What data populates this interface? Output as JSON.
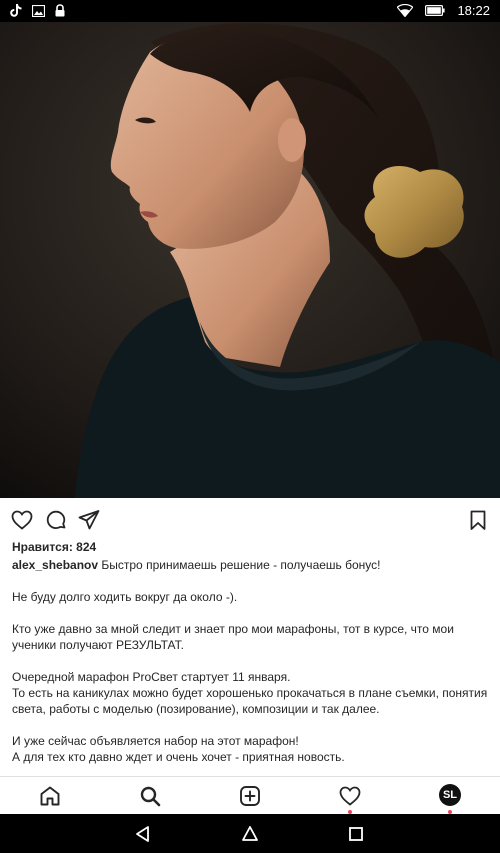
{
  "status_bar": {
    "time": "18:22",
    "icons": [
      "tiktok-icon",
      "image-icon",
      "lock-icon",
      "wifi-icon",
      "battery-icon"
    ]
  },
  "post": {
    "photo": "portrait-photo",
    "actions": [
      "heart-icon",
      "comment-icon",
      "share-icon",
      "bookmark-icon"
    ],
    "likes": "Нравится: 824",
    "username": "alex_shebanov",
    "caption_first": "Быстро принимаешь решение - получаешь бонус!",
    "paragraphs": [
      "Не буду долго ходить вокруг да около -).",
      "Кто уже давно за мной следит и знает про мои марафоны, тот в курсе, что мои ученики получают РЕЗУЛЬТАТ.",
      "Очередной марафон ProСвет стартует 11 января.\nТо есть на каникулах можно будет хорошенько прокачаться в плане съемки, понятия света, работы с моделью (позирование), композиции и так далее.",
      "И уже сейчас объявляется набор на этот марафон!\nА для тех кто давно ждет и очень хочет - приятная новость."
    ]
  },
  "bottom_nav": {
    "items": [
      "home-icon",
      "search-icon",
      "add-post-icon",
      "activity-icon",
      "profile-avatar"
    ],
    "avatar_text": "SL"
  },
  "system_nav": [
    "back-icon",
    "home-button-icon",
    "recents-icon"
  ]
}
